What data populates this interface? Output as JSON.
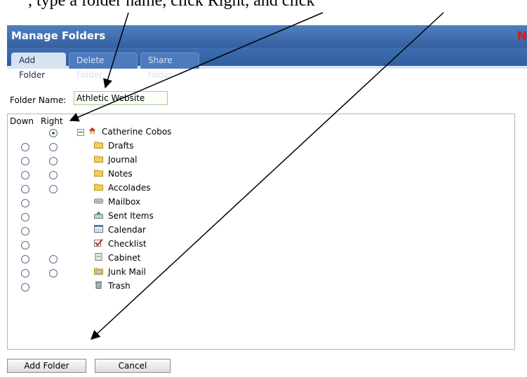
{
  "header_instruction": ", type a folder name, click Right, and click",
  "dialog": {
    "title": "Manage Folders",
    "brand_letter": "N"
  },
  "tabs": [
    {
      "label": "Add Folder",
      "active": true
    },
    {
      "label": "Delete Folder",
      "active": false
    },
    {
      "label": "Share folder",
      "active": false
    }
  ],
  "form": {
    "folder_name_label": "Folder Name:",
    "folder_name_value": "Athletic Website"
  },
  "columns": {
    "down": "Down",
    "right": "Right"
  },
  "tree": {
    "root": {
      "label": "Catherine Cobos",
      "icon": "home-icon"
    },
    "items": [
      {
        "label": "Drafts",
        "icon": "folder-icon",
        "down": true,
        "right": true
      },
      {
        "label": "Journal",
        "icon": "folder-icon",
        "down": true,
        "right": true
      },
      {
        "label": "Notes",
        "icon": "folder-icon",
        "down": true,
        "right": true
      },
      {
        "label": "Accolades",
        "icon": "folder-icon",
        "down": true,
        "right": true
      },
      {
        "label": "Mailbox",
        "icon": "mailbox-icon",
        "down": true,
        "right": false
      },
      {
        "label": "Sent Items",
        "icon": "sent-items-icon",
        "down": true,
        "right": false
      },
      {
        "label": "Calendar",
        "icon": "calendar-icon",
        "down": true,
        "right": false
      },
      {
        "label": "Checklist",
        "icon": "checklist-icon",
        "down": true,
        "right": false
      },
      {
        "label": "Cabinet",
        "icon": "cabinet-icon",
        "down": true,
        "right": true
      },
      {
        "label": "Junk Mail",
        "icon": "junk-mail-icon",
        "down": true,
        "right": true
      },
      {
        "label": "Trash",
        "icon": "trash-icon",
        "down": true,
        "right": false
      }
    ]
  },
  "buttons": {
    "add": "Add Folder",
    "cancel": "Cancel"
  },
  "colors": {
    "titlebar": "#34609f",
    "brand": "#e0161b",
    "selected_radio": "#2e8b2e",
    "folder": "#f0c030"
  }
}
